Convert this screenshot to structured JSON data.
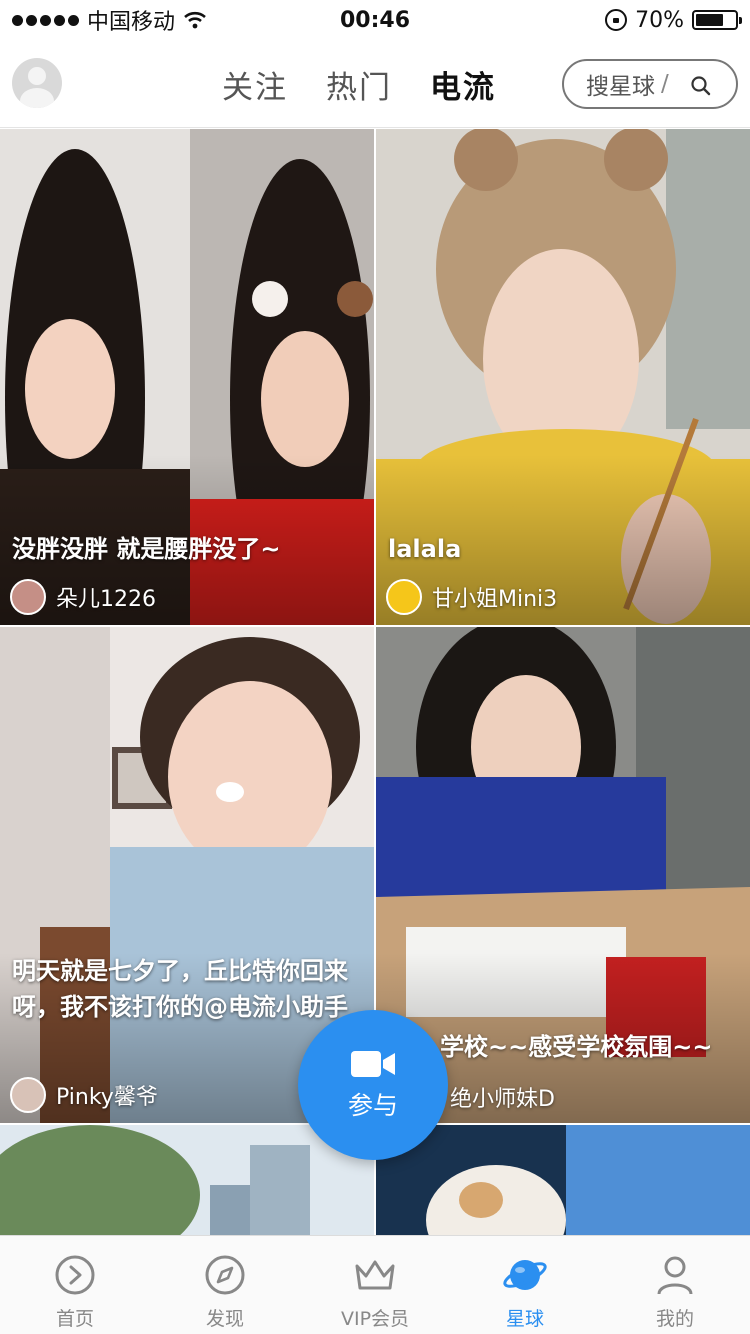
{
  "status_bar": {
    "carrier": "中国移动",
    "time": "00:46",
    "battery_text": "70%",
    "battery_level": 0.7
  },
  "header": {
    "tabs": [
      {
        "label": "关注",
        "active": false
      },
      {
        "label": "热门",
        "active": false
      },
      {
        "label": "电流",
        "active": true
      }
    ],
    "search_label": "搜星球",
    "search_separator": "/"
  },
  "feed": [
    {
      "title": "没胖没胖 就是腰胖没了~",
      "user": "朵儿1226"
    },
    {
      "title": "lalala",
      "user": "甘小姐Mini3"
    },
    {
      "title": "明天就是七夕了，丘比特你回来呀，我不该打你的@电流小助手",
      "user": "Pinky馨爷"
    },
    {
      "title": "学校~~感受学校氛围~~",
      "user": "绝小师妹D"
    }
  ],
  "fab": {
    "label": "参与",
    "icon": "video-camera-icon"
  },
  "tabbar": [
    {
      "label": "首页",
      "icon": "play-circle-icon",
      "active": false
    },
    {
      "label": "发现",
      "icon": "compass-icon",
      "active": false
    },
    {
      "label": "VIP会员",
      "icon": "crown-icon",
      "active": false
    },
    {
      "label": "星球",
      "icon": "planet-icon",
      "active": true
    },
    {
      "label": "我的",
      "icon": "person-icon",
      "active": false
    }
  ],
  "colors": {
    "accent": "#2b8ff0",
    "tab_inactive": "#888888"
  }
}
